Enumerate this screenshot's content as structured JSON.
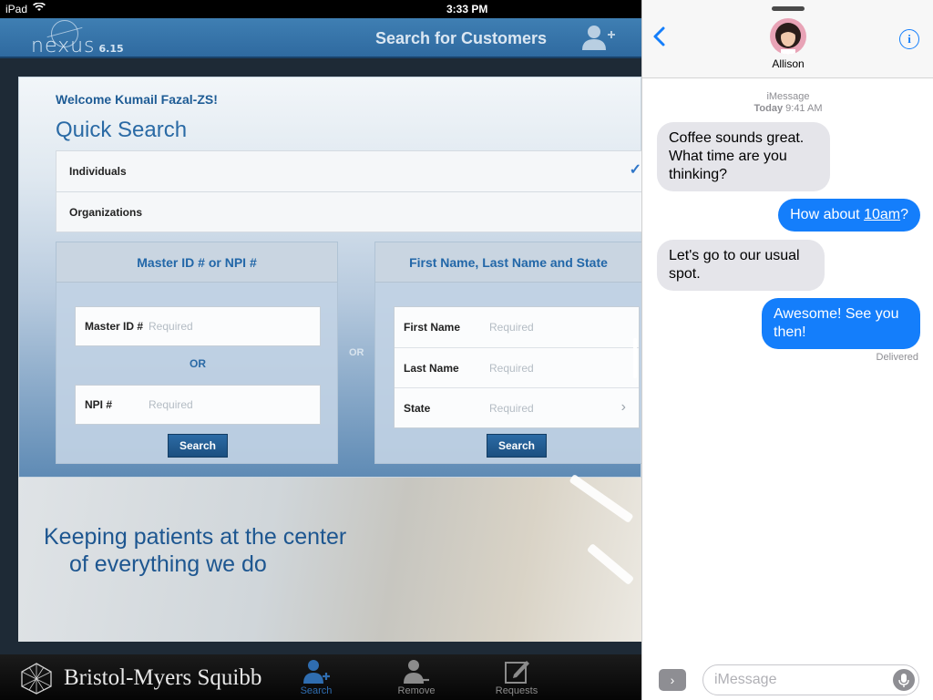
{
  "status_bar": {
    "device": "iPad",
    "time": "3:33 PM"
  },
  "app": {
    "logo": "nexus",
    "version": "6.15",
    "header_title": "Search for Customers",
    "welcome": "Welcome Kumail Fazal-ZS!",
    "quick_search_title": "Quick Search",
    "search_types": [
      {
        "label": "Individuals",
        "selected": true
      },
      {
        "label": "Organizations",
        "selected": false
      }
    ],
    "id_card": {
      "title": "Master ID # or NPI #",
      "fields": [
        {
          "label": "Master ID #",
          "placeholder": "Required"
        },
        {
          "label": "NPI #",
          "placeholder": "Required"
        }
      ],
      "or_label": "OR",
      "search_label": "Search"
    },
    "or_label": "OR",
    "name_card": {
      "title": "First Name, Last Name and State",
      "fields": [
        {
          "label": "First Name",
          "placeholder": "Required"
        },
        {
          "label": "Last Name",
          "placeholder": "Required"
        },
        {
          "label": "State",
          "placeholder": "Required"
        }
      ],
      "search_label": "Search"
    },
    "tagline_line1": "Keeping patients at the center",
    "tagline_line2": "of everything we do",
    "company": "Bristol-Myers Squibb",
    "tabs": [
      {
        "label": "Search",
        "icon": "user-add-icon",
        "active": true
      },
      {
        "label": "Remove",
        "icon": "user-remove-icon",
        "active": false
      },
      {
        "label": "Requests",
        "icon": "compose-icon",
        "active": false
      }
    ]
  },
  "messages": {
    "contact": "Allison",
    "service": "iMessage",
    "date_label": "Today",
    "time_label": "9:41 AM",
    "thread": [
      {
        "from": "them",
        "text": "Coffee sounds great. What time are you thinking?"
      },
      {
        "from": "me",
        "text_before": "How about ",
        "text_link": "10am",
        "text_after": "?"
      },
      {
        "from": "them",
        "text": "Let's go to our usual spot."
      },
      {
        "from": "me",
        "text": "Awesome! See you then!"
      }
    ],
    "delivered": "Delivered",
    "input_placeholder": "iMessage",
    "colors": {
      "outgoing": "#147efb",
      "incoming": "#e5e5ea"
    }
  }
}
